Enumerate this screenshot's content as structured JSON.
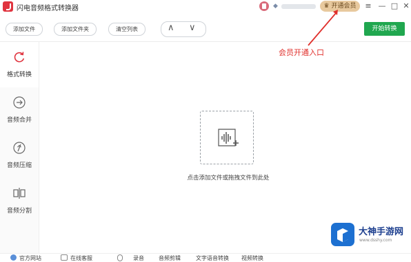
{
  "window": {
    "title": "闪电音频格式转换器",
    "vip_label": "开通会员",
    "controls": [
      "≡",
      "—",
      "□",
      "✕"
    ]
  },
  "toolbar": {
    "add_file": "添加文件",
    "add_folder": "添加文件夹",
    "clear_list": "清空列表",
    "move_up": "∧",
    "move_down": "∨",
    "start": "开始转换"
  },
  "sidebar": {
    "items": [
      {
        "label": "格式转换",
        "icon": "refresh-icon",
        "active": true
      },
      {
        "label": "音频合并",
        "icon": "merge-icon",
        "active": false
      },
      {
        "label": "音频压缩",
        "icon": "compress-icon",
        "active": false
      },
      {
        "label": "音频分割",
        "icon": "split-icon",
        "active": false
      }
    ]
  },
  "main": {
    "drop_text": "点击添加文件或拖拽文件到此处"
  },
  "annotation": {
    "text": "会员开通入口",
    "color": "#e0302c"
  },
  "footer": {
    "items": [
      "官方网站",
      "在线客服",
      "录音",
      "音频剪辑",
      "文字语音转换",
      "视频转换"
    ]
  },
  "watermark": {
    "title": "大神手游网",
    "url": "www.dsshy.com"
  },
  "colors": {
    "accent_green": "#20a74f",
    "vip_gold": "#e8c99e"
  }
}
